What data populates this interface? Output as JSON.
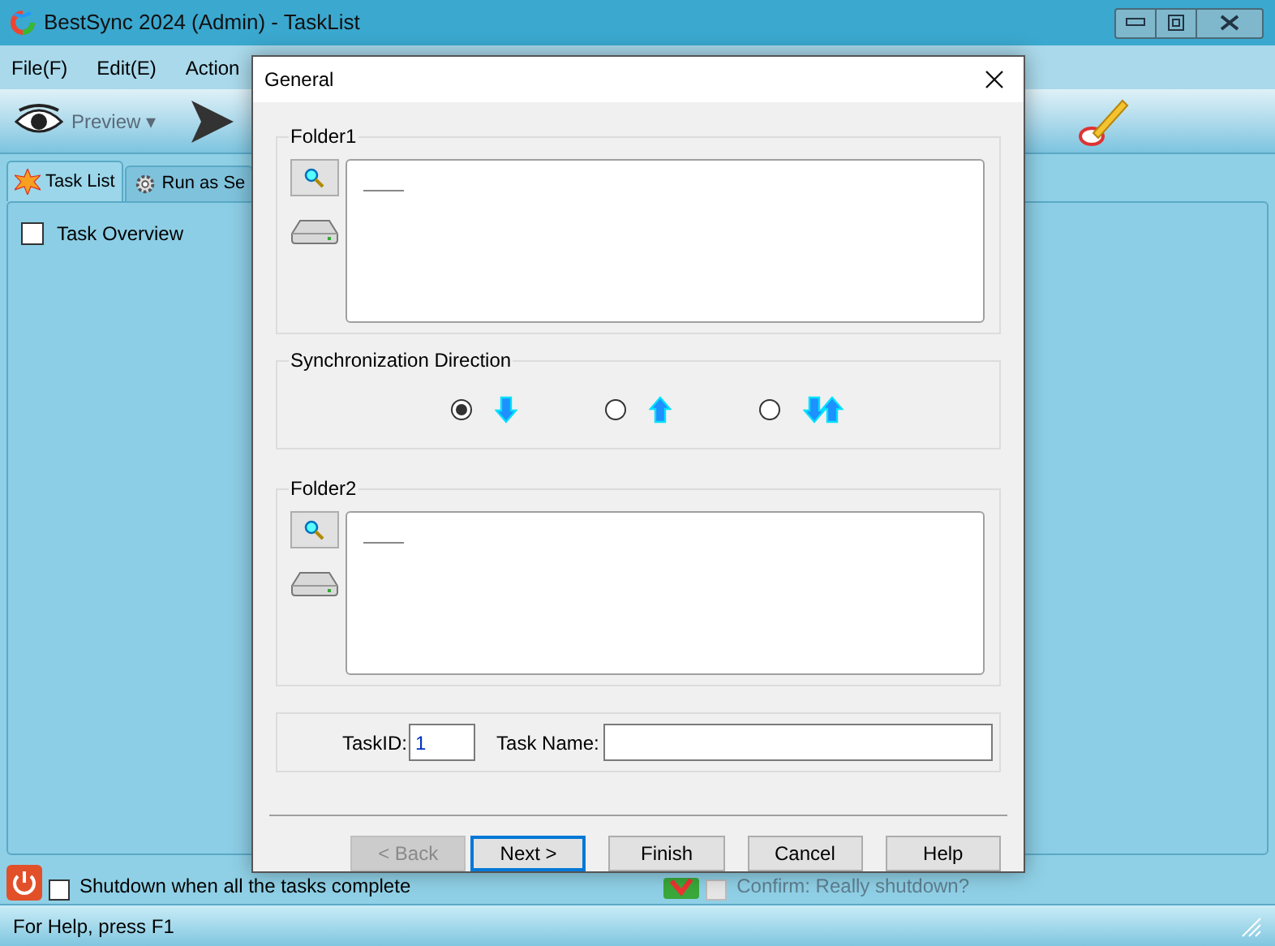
{
  "window": {
    "title": "BestSync 2024 (Admin) - TaskList"
  },
  "menu": [
    "File(F)",
    "Edit(E)",
    "Action"
  ],
  "toolbar": [
    {
      "label": "Preview ▾",
      "kind": "eye"
    }
  ],
  "tabs": [
    {
      "label": "Task List",
      "selected": true,
      "kind": "star"
    },
    {
      "label": "Run as Se",
      "selected": false,
      "kind": "gear"
    }
  ],
  "task_overview": {
    "label": "Task Overview",
    "checked": false
  },
  "shutdown": {
    "label": "Shutdown when all the tasks complete",
    "checked": false
  },
  "confirm": {
    "label": "Confirm: Really shutdown?",
    "checked": false,
    "disabled": true
  },
  "status_bar": "For Help, press F1",
  "dialog": {
    "title": "General",
    "folder1": {
      "label": "Folder1"
    },
    "direction": {
      "label": "Synchronization Direction",
      "options": [
        {
          "kind": "down",
          "selected": true
        },
        {
          "kind": "up",
          "selected": false
        },
        {
          "kind": "both",
          "selected": false
        }
      ]
    },
    "folder2": {
      "label": "Folder2"
    },
    "task_id": {
      "label": "TaskID:",
      "value": "1"
    },
    "task_name": {
      "label": "Task Name:"
    },
    "buttons": [
      {
        "label": "< Back",
        "disabled": true,
        "default": false
      },
      {
        "label": "Next >",
        "disabled": false,
        "default": true
      },
      {
        "label": "Finish",
        "disabled": false,
        "default": false
      },
      {
        "label": "Cancel",
        "disabled": false,
        "default": false
      },
      {
        "label": "Help",
        "disabled": false,
        "default": false
      }
    ]
  }
}
